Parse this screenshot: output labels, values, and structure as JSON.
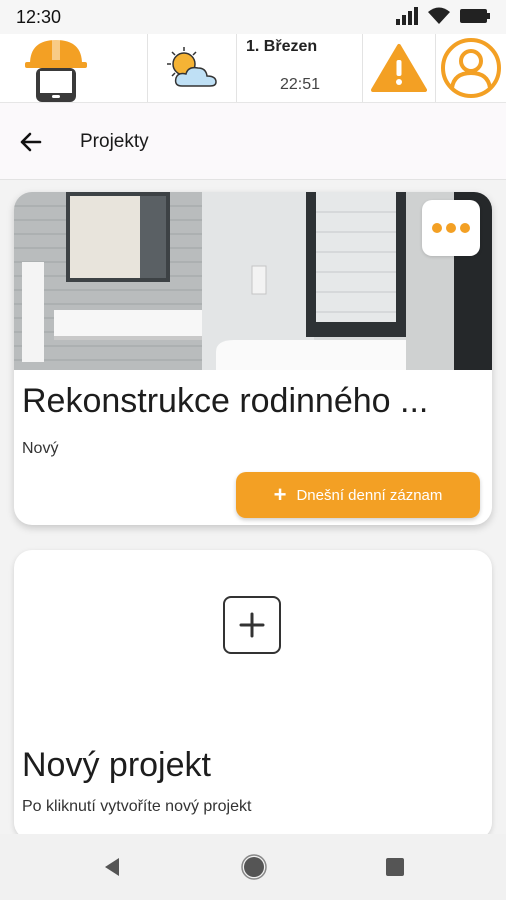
{
  "status_bar": {
    "time": "12:30",
    "icons": [
      "signal-icon",
      "wifi-icon",
      "battery-icon"
    ]
  },
  "header": {
    "logo_icon": "helmet-phone-logo",
    "weather_icon": "partly-cloudy-icon",
    "date": "1. Březen",
    "time": "22:51",
    "alert_icon": "warning-icon",
    "profile_icon": "user-profile-icon",
    "accent_color": "#f3a024"
  },
  "title_bar": {
    "title": "Projekty",
    "back_icon": "arrow-left-icon"
  },
  "projects": [
    {
      "name": "Rekonstrukce rodinného ...",
      "status": "Nový",
      "more_icon": "more-dots-icon",
      "action_label": "Dnešní denní záznam",
      "action_icon": "plus-icon"
    }
  ],
  "new_project": {
    "title": "Nový projekt",
    "description": "Po kliknutí vytvoříte nový projekt",
    "icon": "add-square-icon"
  },
  "nav_bar": {
    "buttons": [
      "back-triangle-icon",
      "home-circle-icon",
      "recents-square-icon"
    ]
  }
}
